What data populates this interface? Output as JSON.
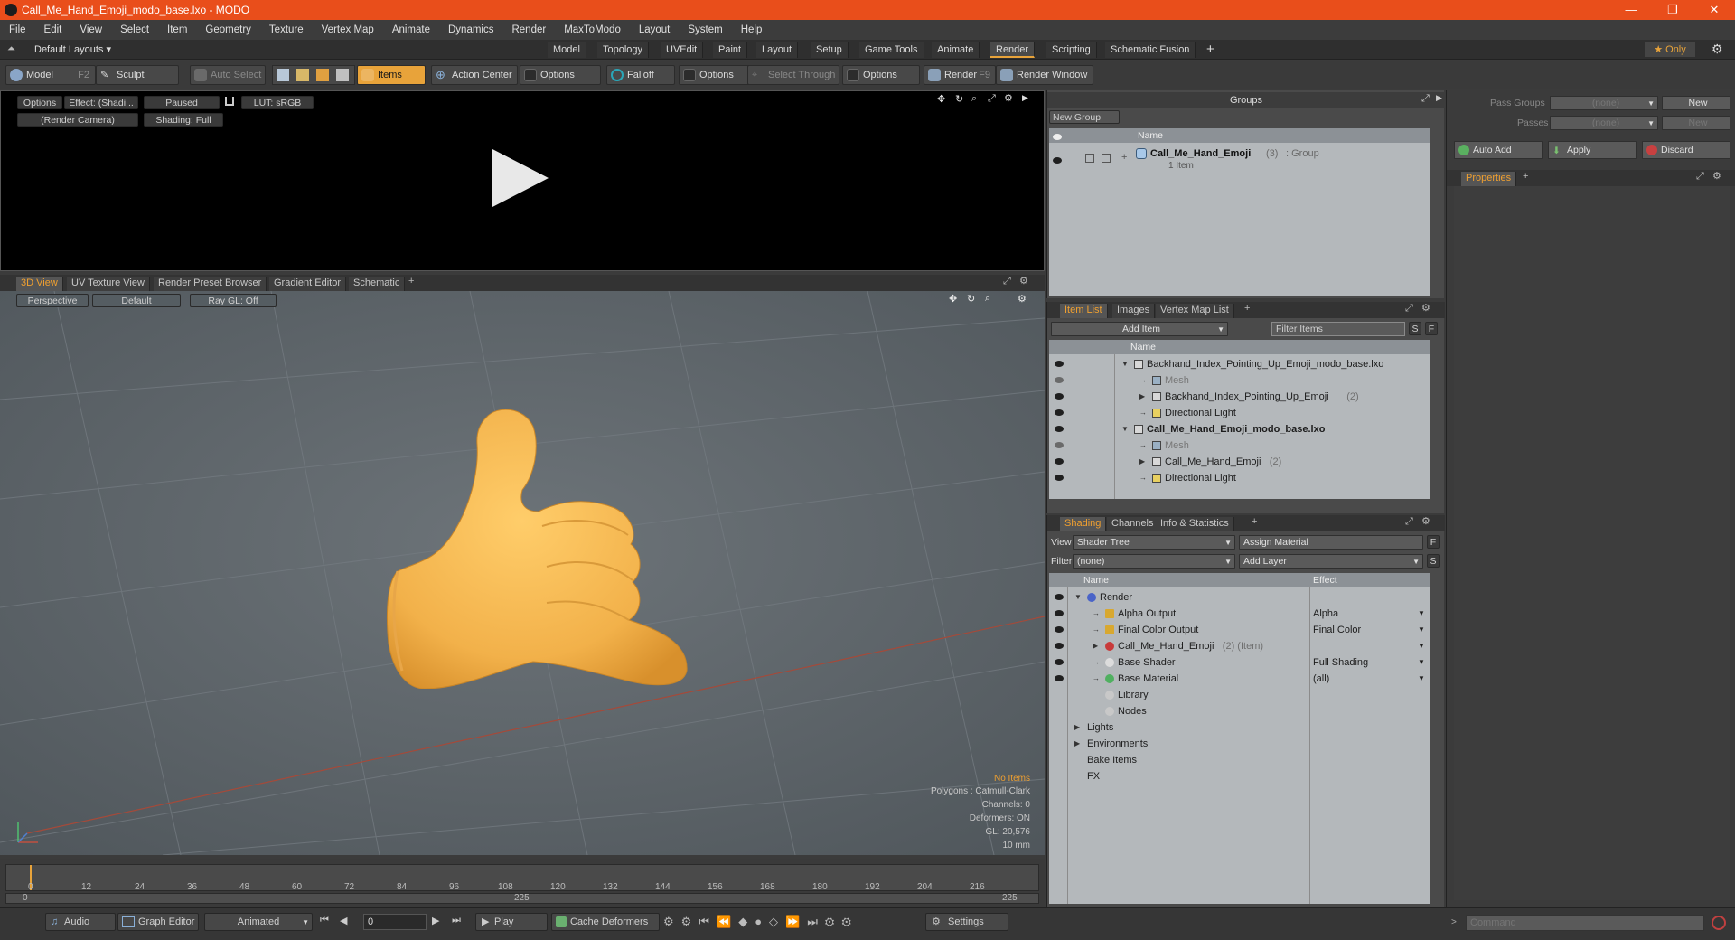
{
  "window": {
    "title": "Call_Me_Hand_Emoji_modo_base.lxo - MODO",
    "minimize": "—",
    "maximize": "❐",
    "close": "✕"
  },
  "menu": [
    "File",
    "Edit",
    "View",
    "Select",
    "Item",
    "Geometry",
    "Texture",
    "Vertex Map",
    "Animate",
    "Dynamics",
    "Render",
    "MaxToModo",
    "Layout",
    "System",
    "Help"
  ],
  "layout_bar": {
    "layouts_label": "Default Layouts ▾",
    "tabs": [
      "Model",
      "Topology",
      "UVEdit",
      "Paint",
      "Layout",
      "Setup",
      "Game Tools",
      "Animate",
      "Render",
      "Scripting",
      "Schematic Fusion"
    ],
    "active_tab": "Render",
    "add": "+",
    "only_label": "★ Only"
  },
  "toolbar": {
    "model": "Model",
    "model_key": "F2",
    "sculpt": "Sculpt",
    "auto_select": "Auto Select",
    "items": "Items",
    "action_center": "Action Center",
    "options1": "Options",
    "falloff": "Falloff",
    "options2": "Options",
    "select_through": "Select Through",
    "options3": "Options",
    "render": "Render",
    "render_key": "F9",
    "render_window": "Render Window"
  },
  "render_panel": {
    "options": "Options",
    "effect": "Effect: (Shadi...",
    "paused": "Paused",
    "lut": "LUT: sRGB",
    "camera": "(Render Camera)",
    "shading": "Shading: Full"
  },
  "viewport_tabs": [
    "3D View",
    "UV Texture View",
    "Render Preset Browser",
    "Gradient Editor",
    "Schematic"
  ],
  "viewport": {
    "perspective": "Perspective",
    "default": "Default",
    "raygl": "Ray GL: Off",
    "stats": {
      "no_items": "No Items",
      "polygons": "Polygons : Catmull-Clark",
      "channels": "Channels: 0",
      "deformers": "Deformers: ON",
      "gl": "GL: 20,576",
      "scale": "10 mm"
    }
  },
  "timeline": {
    "ticks": [
      "0",
      "12",
      "24",
      "36",
      "48",
      "60",
      "72",
      "84",
      "96",
      "108",
      "120",
      "132",
      "144",
      "156",
      "168",
      "180",
      "192",
      "204",
      "216"
    ],
    "start": "0",
    "end": "225",
    "mid": "225"
  },
  "bottom_bar": {
    "audio": "Audio",
    "graph_editor": "Graph Editor",
    "animated": "Animated",
    "frame": "0",
    "play": "Play",
    "cache_deformers": "Cache Deformers",
    "settings": "Settings"
  },
  "groups": {
    "title": "Groups",
    "new_group": "New Group",
    "col_name": "Name",
    "item_name": "Call_Me_Hand_Emoji",
    "item_count": "(3)",
    "item_type": ": Group",
    "item_sub": "1 Item"
  },
  "item_list": {
    "tabs": [
      "Item List",
      "Images",
      "Vertex Map List"
    ],
    "add_item": "Add Item",
    "filter_items": "Filter Items",
    "s": "S",
    "f": "F",
    "col_name": "Name",
    "rows": [
      {
        "label": "Backhand_Index_Pointing_Up_Emoji_modo_base.lxo",
        "extra": "",
        "indent": 0,
        "bold": false,
        "grey": false
      },
      {
        "label": "Mesh",
        "extra": "",
        "indent": 1,
        "bold": false,
        "grey": true
      },
      {
        "label": "Backhand_Index_Pointing_Up_Emoji",
        "extra": "(2)",
        "indent": 1,
        "bold": false,
        "grey": false
      },
      {
        "label": "Directional Light",
        "extra": "",
        "indent": 1,
        "bold": false,
        "grey": false
      },
      {
        "label": "Call_Me_Hand_Emoji_modo_base.lxo",
        "extra": "",
        "indent": 0,
        "bold": true,
        "grey": false
      },
      {
        "label": "Mesh",
        "extra": "",
        "indent": 1,
        "bold": false,
        "grey": true
      },
      {
        "label": "Call_Me_Hand_Emoji",
        "extra": "(2)",
        "indent": 1,
        "bold": false,
        "grey": false
      },
      {
        "label": "Directional Light",
        "extra": "",
        "indent": 1,
        "bold": false,
        "grey": false
      }
    ]
  },
  "shading": {
    "tabs": [
      "Shading",
      "Channels",
      "Info & Statistics"
    ],
    "view_label": "View",
    "view_value": "Shader Tree",
    "assign_material": "Assign Material",
    "filter_label": "Filter",
    "filter_value": "(none)",
    "add_layer": "Add Layer",
    "col_name": "Name",
    "col_effect": "Effect",
    "rows": [
      {
        "name": "Render",
        "extra": "",
        "effect": "",
        "level": 0
      },
      {
        "name": "Alpha Output",
        "extra": "",
        "effect": "Alpha",
        "level": 1
      },
      {
        "name": "Final Color Output",
        "extra": "",
        "effect": "Final Color",
        "level": 1
      },
      {
        "name": "Call_Me_Hand_Emoji",
        "extra": "(2) (Item)",
        "effect": "",
        "level": 1
      },
      {
        "name": "Base Shader",
        "extra": "",
        "effect": "Full Shading",
        "level": 1
      },
      {
        "name": "Base Material",
        "extra": "",
        "effect": "(all)",
        "level": 1
      },
      {
        "name": "Library",
        "extra": "",
        "effect": "",
        "level": 1
      },
      {
        "name": "Nodes",
        "extra": "",
        "effect": "",
        "level": 1
      },
      {
        "name": "Lights",
        "extra": "",
        "effect": "",
        "level": 0
      },
      {
        "name": "Environments",
        "extra": "",
        "effect": "",
        "level": 0
      },
      {
        "name": "Bake Items",
        "extra": "",
        "effect": "",
        "level": 0
      },
      {
        "name": "FX",
        "extra": "",
        "effect": "",
        "level": 0
      }
    ]
  },
  "pass_panel": {
    "pass_groups": "Pass Groups",
    "passes": "Passes",
    "none": "(none)",
    "new": "New",
    "auto_add": "Auto Add",
    "apply": "Apply",
    "discard": "Discard",
    "properties": "Properties"
  },
  "command": {
    "placeholder": "Command"
  },
  "colors": {
    "accent": "#e8a33a",
    "titlebar": "#e94e1b",
    "hand": "#f2b14a"
  }
}
